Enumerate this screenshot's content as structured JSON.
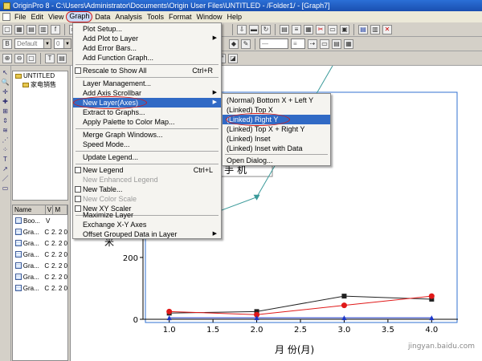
{
  "window": {
    "title": "OriginPro 8 - C:\\Users\\Administrator\\Documents\\Origin User Files\\UNTITLED - /Folder1/ - [Graph7]"
  },
  "menubar": [
    "File",
    "Edit",
    "View",
    "Graph",
    "Data",
    "Analysis",
    "Tools",
    "Format",
    "Window",
    "Help"
  ],
  "toolbar": {
    "font_combo": "Default",
    "size_combo": "0"
  },
  "explorer": {
    "root": "UNTITLED",
    "child": "家电销售"
  },
  "filelist": {
    "headers": [
      "Name",
      "V",
      "M"
    ],
    "rows": [
      {
        "name": "Boo...",
        "c1": "V",
        "c2": ""
      },
      {
        "name": "Gra...",
        "c1": "C",
        "c2": "2. 2 0"
      },
      {
        "name": "Gra...",
        "c1": "C",
        "c2": "2. 2 0"
      },
      {
        "name": "Gra...",
        "c1": "C",
        "c2": "2. 2 0"
      },
      {
        "name": "Gra...",
        "c1": "C",
        "c2": "2. 2 0"
      },
      {
        "name": "Gra...",
        "c1": "C",
        "c2": "2. 2 0"
      },
      {
        "name": "Gra...",
        "c1": "C",
        "c2": "2. 2 0"
      }
    ]
  },
  "graph_menu": {
    "items": [
      {
        "label": "Plot Setup...",
        "shortcut": ""
      },
      {
        "label": "Add Plot to Layer",
        "submenu": true
      },
      {
        "label": "Add Error Bars...",
        "shortcut": ""
      },
      {
        "label": "Add Function Graph...",
        "shortcut": ""
      },
      {
        "label": "Rescale to Show All",
        "shortcut": "Ctrl+R"
      },
      {
        "label": "Layer Management...",
        "shortcut": ""
      },
      {
        "label": "Add Axis Scrollbar",
        "submenu": true
      },
      {
        "label": "New Layer(Axes)",
        "submenu": true
      },
      {
        "label": "Extract to Graphs...",
        "shortcut": ""
      },
      {
        "label": "Apply Palette to Color Map...",
        "shortcut": ""
      },
      {
        "label": "Merge Graph Windows...",
        "shortcut": ""
      },
      {
        "label": "Speed Mode...",
        "shortcut": ""
      },
      {
        "label": "Update Legend...",
        "shortcut": ""
      },
      {
        "label": "New Legend",
        "shortcut": "Ctrl+L"
      },
      {
        "label": "New Enhanced Legend",
        "shortcut": ""
      },
      {
        "label": "New Table...",
        "shortcut": ""
      },
      {
        "label": "New Color Scale",
        "shortcut": ""
      },
      {
        "label": "New XY Scaler",
        "shortcut": ""
      },
      {
        "label": "Maximize Layer",
        "shortcut": ""
      },
      {
        "label": "Exchange X-Y Axes",
        "shortcut": ""
      },
      {
        "label": "Offset Grouped Data in Layer",
        "submenu": true
      }
    ]
  },
  "submenu": {
    "items": [
      "(Normal) Bottom X + Left Y",
      "(Linked) Top X",
      "(Linked) Right Y",
      "(Linked) Top X + Right Y",
      "(Linked) Inset",
      "(Linked) Inset with Data",
      "Open Dialog..."
    ]
  },
  "graph": {
    "text_label": "- 手 机",
    "xlabel": "月 份(月)",
    "y_axis_mark": "米"
  },
  "chart_data": {
    "type": "line",
    "x": [
      1.0,
      2.0,
      3.0,
      4.0
    ],
    "x_ticks": [
      "1.0",
      "1.5",
      "2.0",
      "2.5",
      "3.0",
      "3.5",
      "4.0"
    ],
    "y_ticks": [
      "0",
      "200"
    ],
    "xlabel": "月 份(月)",
    "xlim": [
      0.7,
      4.3
    ],
    "ylim": [
      0,
      820
    ],
    "series": [
      {
        "values": [
          290,
          395,
          885,
          1010
        ],
        "color": "#3a9a9a",
        "marker": "triangle-down"
      },
      {
        "values": [
          20,
          25,
          75,
          65
        ],
        "color": "#222222",
        "marker": "square"
      },
      {
        "values": [
          25,
          15,
          45,
          75
        ],
        "color": "#e01818",
        "marker": "circle"
      },
      {
        "values": [
          5,
          5,
          5,
          5
        ],
        "color": "#1a36c8",
        "marker": "triangle-up"
      }
    ]
  },
  "watermark": "jingyan.baidu.com"
}
